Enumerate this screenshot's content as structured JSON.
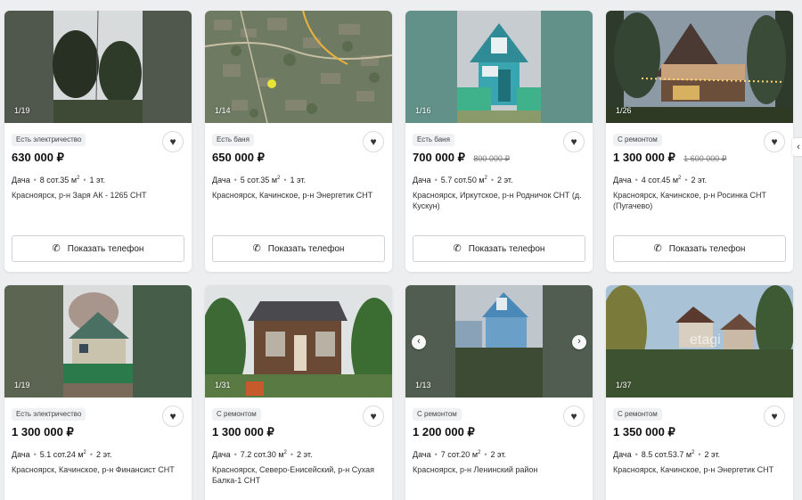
{
  "listings": [
    {
      "photo_counter": "1/19",
      "badge": "Есть электричество",
      "price": "630 000 ₽",
      "old_price": "",
      "type": "Дача",
      "area": "8 сот.35 м",
      "area_sup": "2",
      "floors": "1 эт.",
      "address": "Красноярск, р-н Заря АК - 1265 СНТ",
      "button": "Показать телефон"
    },
    {
      "photo_counter": "1/14",
      "badge": "Есть баня",
      "price": "650 000 ₽",
      "old_price": "",
      "type": "Дача",
      "area": "5 сот.35 м",
      "area_sup": "2",
      "floors": "1 эт.",
      "address": "Красноярск, Качинское, р-н Энергетик СНТ",
      "button": "Показать телефон"
    },
    {
      "photo_counter": "1/16",
      "badge": "Есть баня",
      "price": "700 000 ₽",
      "old_price": "800 000 ₽",
      "type": "Дача",
      "area": "5.7 сот.50 м",
      "area_sup": "2",
      "floors": "2 эт.",
      "address": "Красноярск, Иркутское, р-н Родничок СНТ (д. Кускун)",
      "button": "Показать телефон"
    },
    {
      "photo_counter": "1/26",
      "badge": "С ремонтом",
      "price": "1 300 000 ₽",
      "old_price": "1 600 000 ₽",
      "type": "Дача",
      "area": "4 сот.45 м",
      "area_sup": "2",
      "floors": "2 эт.",
      "address": "Красноярск, Качинское, р-н Росинка СНТ (Пугачево)",
      "button": "Показать телефон"
    },
    {
      "photo_counter": "1/19",
      "badge": "Есть электричество",
      "price": "1 300 000 ₽",
      "old_price": "",
      "type": "Дача",
      "area": "5.1 сот.24 м",
      "area_sup": "2",
      "floors": "2 эт.",
      "address": "Красноярск, Качинское, р-н Финансист СНТ",
      "button": ""
    },
    {
      "photo_counter": "1/31",
      "badge": "С ремонтом",
      "price": "1 300 000 ₽",
      "old_price": "",
      "type": "Дача",
      "area": "7.2 сот.30 м",
      "area_sup": "2",
      "floors": "2 эт.",
      "address": "Красноярск, Северо-Енисейский, р-н Сухая Балка-1 СНТ",
      "button": ""
    },
    {
      "photo_counter": "1/13",
      "badge": "С ремонтом",
      "price": "1 200 000 ₽",
      "old_price": "",
      "type": "Дача",
      "area": "7 сот.20 м",
      "area_sup": "2",
      "floors": "2 эт.",
      "address": "Красноярск, р-н Ленинский район",
      "button": ""
    },
    {
      "photo_counter": "1/37",
      "badge": "С ремонтом",
      "price": "1 350 000 ₽",
      "old_price": "",
      "type": "Дача",
      "area": "8.5 сот.53.7 м",
      "area_sup": "2",
      "floors": "2 эт.",
      "address": "Красноярск, Качинское, р-н Энергетик СНТ",
      "button": ""
    }
  ],
  "watermark": "etagi",
  "icons": {
    "favorite": "heart-icon",
    "phone": "phone-icon",
    "prev": "chevron-left-icon",
    "next": "chevron-right-icon"
  }
}
